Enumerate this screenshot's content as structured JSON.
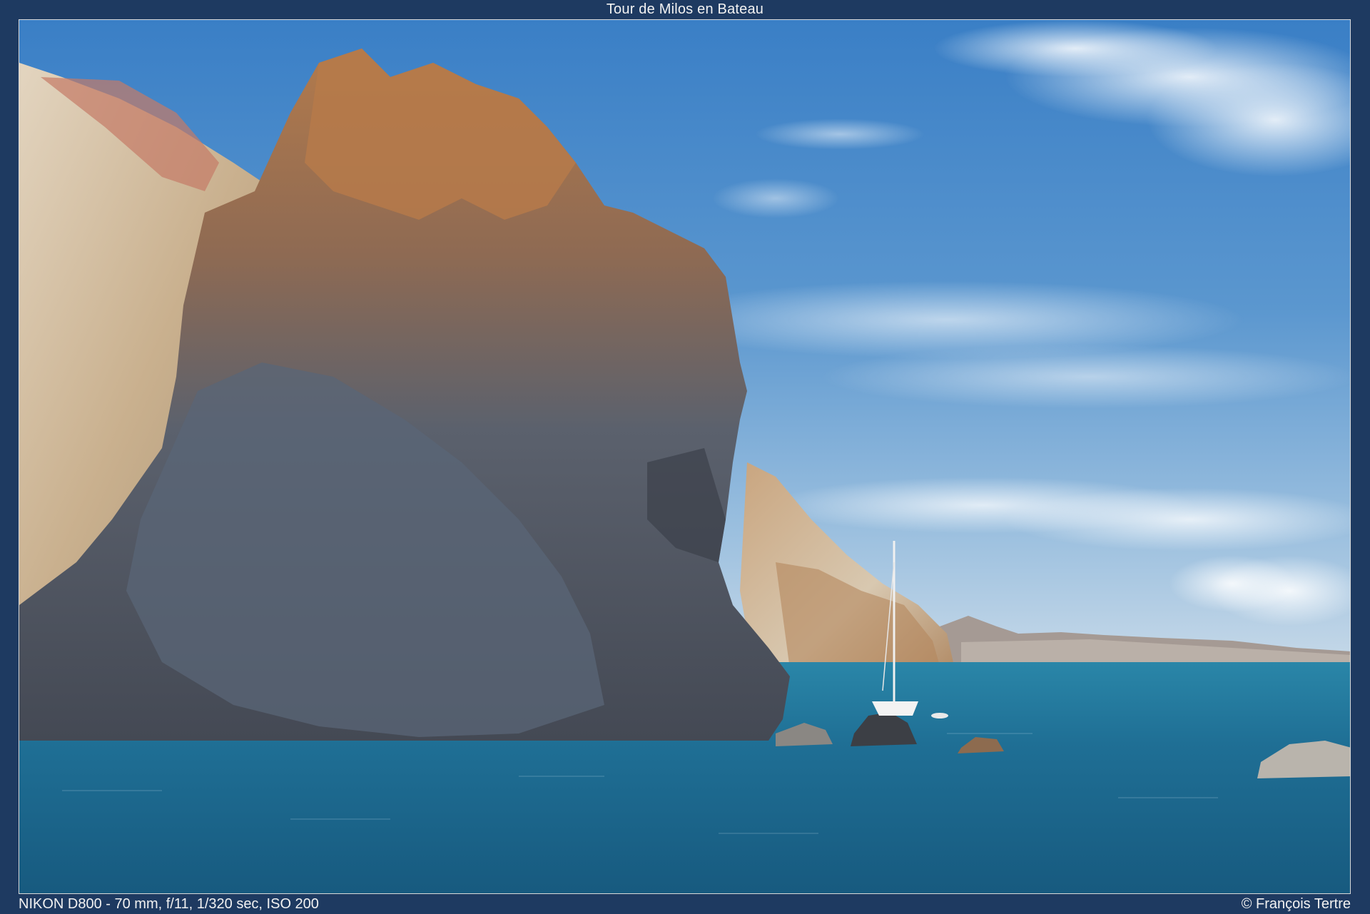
{
  "viewer": {
    "title": "Tour de Milos en Bateau",
    "exif": "NIKON D800 - 70 mm, f/11, 1/320 sec, ISO 200",
    "copyright": "© François Tertre"
  },
  "photo": {
    "subject": "Rocky volcanic sea cliff with a sailboat anchored in a turquoise bay, distant island under a blue sky with clouds"
  },
  "colors": {
    "background": "#1e3a61",
    "sky_top": "#3f83c8",
    "sky_bottom": "#a9c8e2",
    "sea": "#1f6f95",
    "rock_dark": "#4f5560",
    "rock_orange": "#b07444",
    "cliff_light": "#d9c7ad"
  }
}
